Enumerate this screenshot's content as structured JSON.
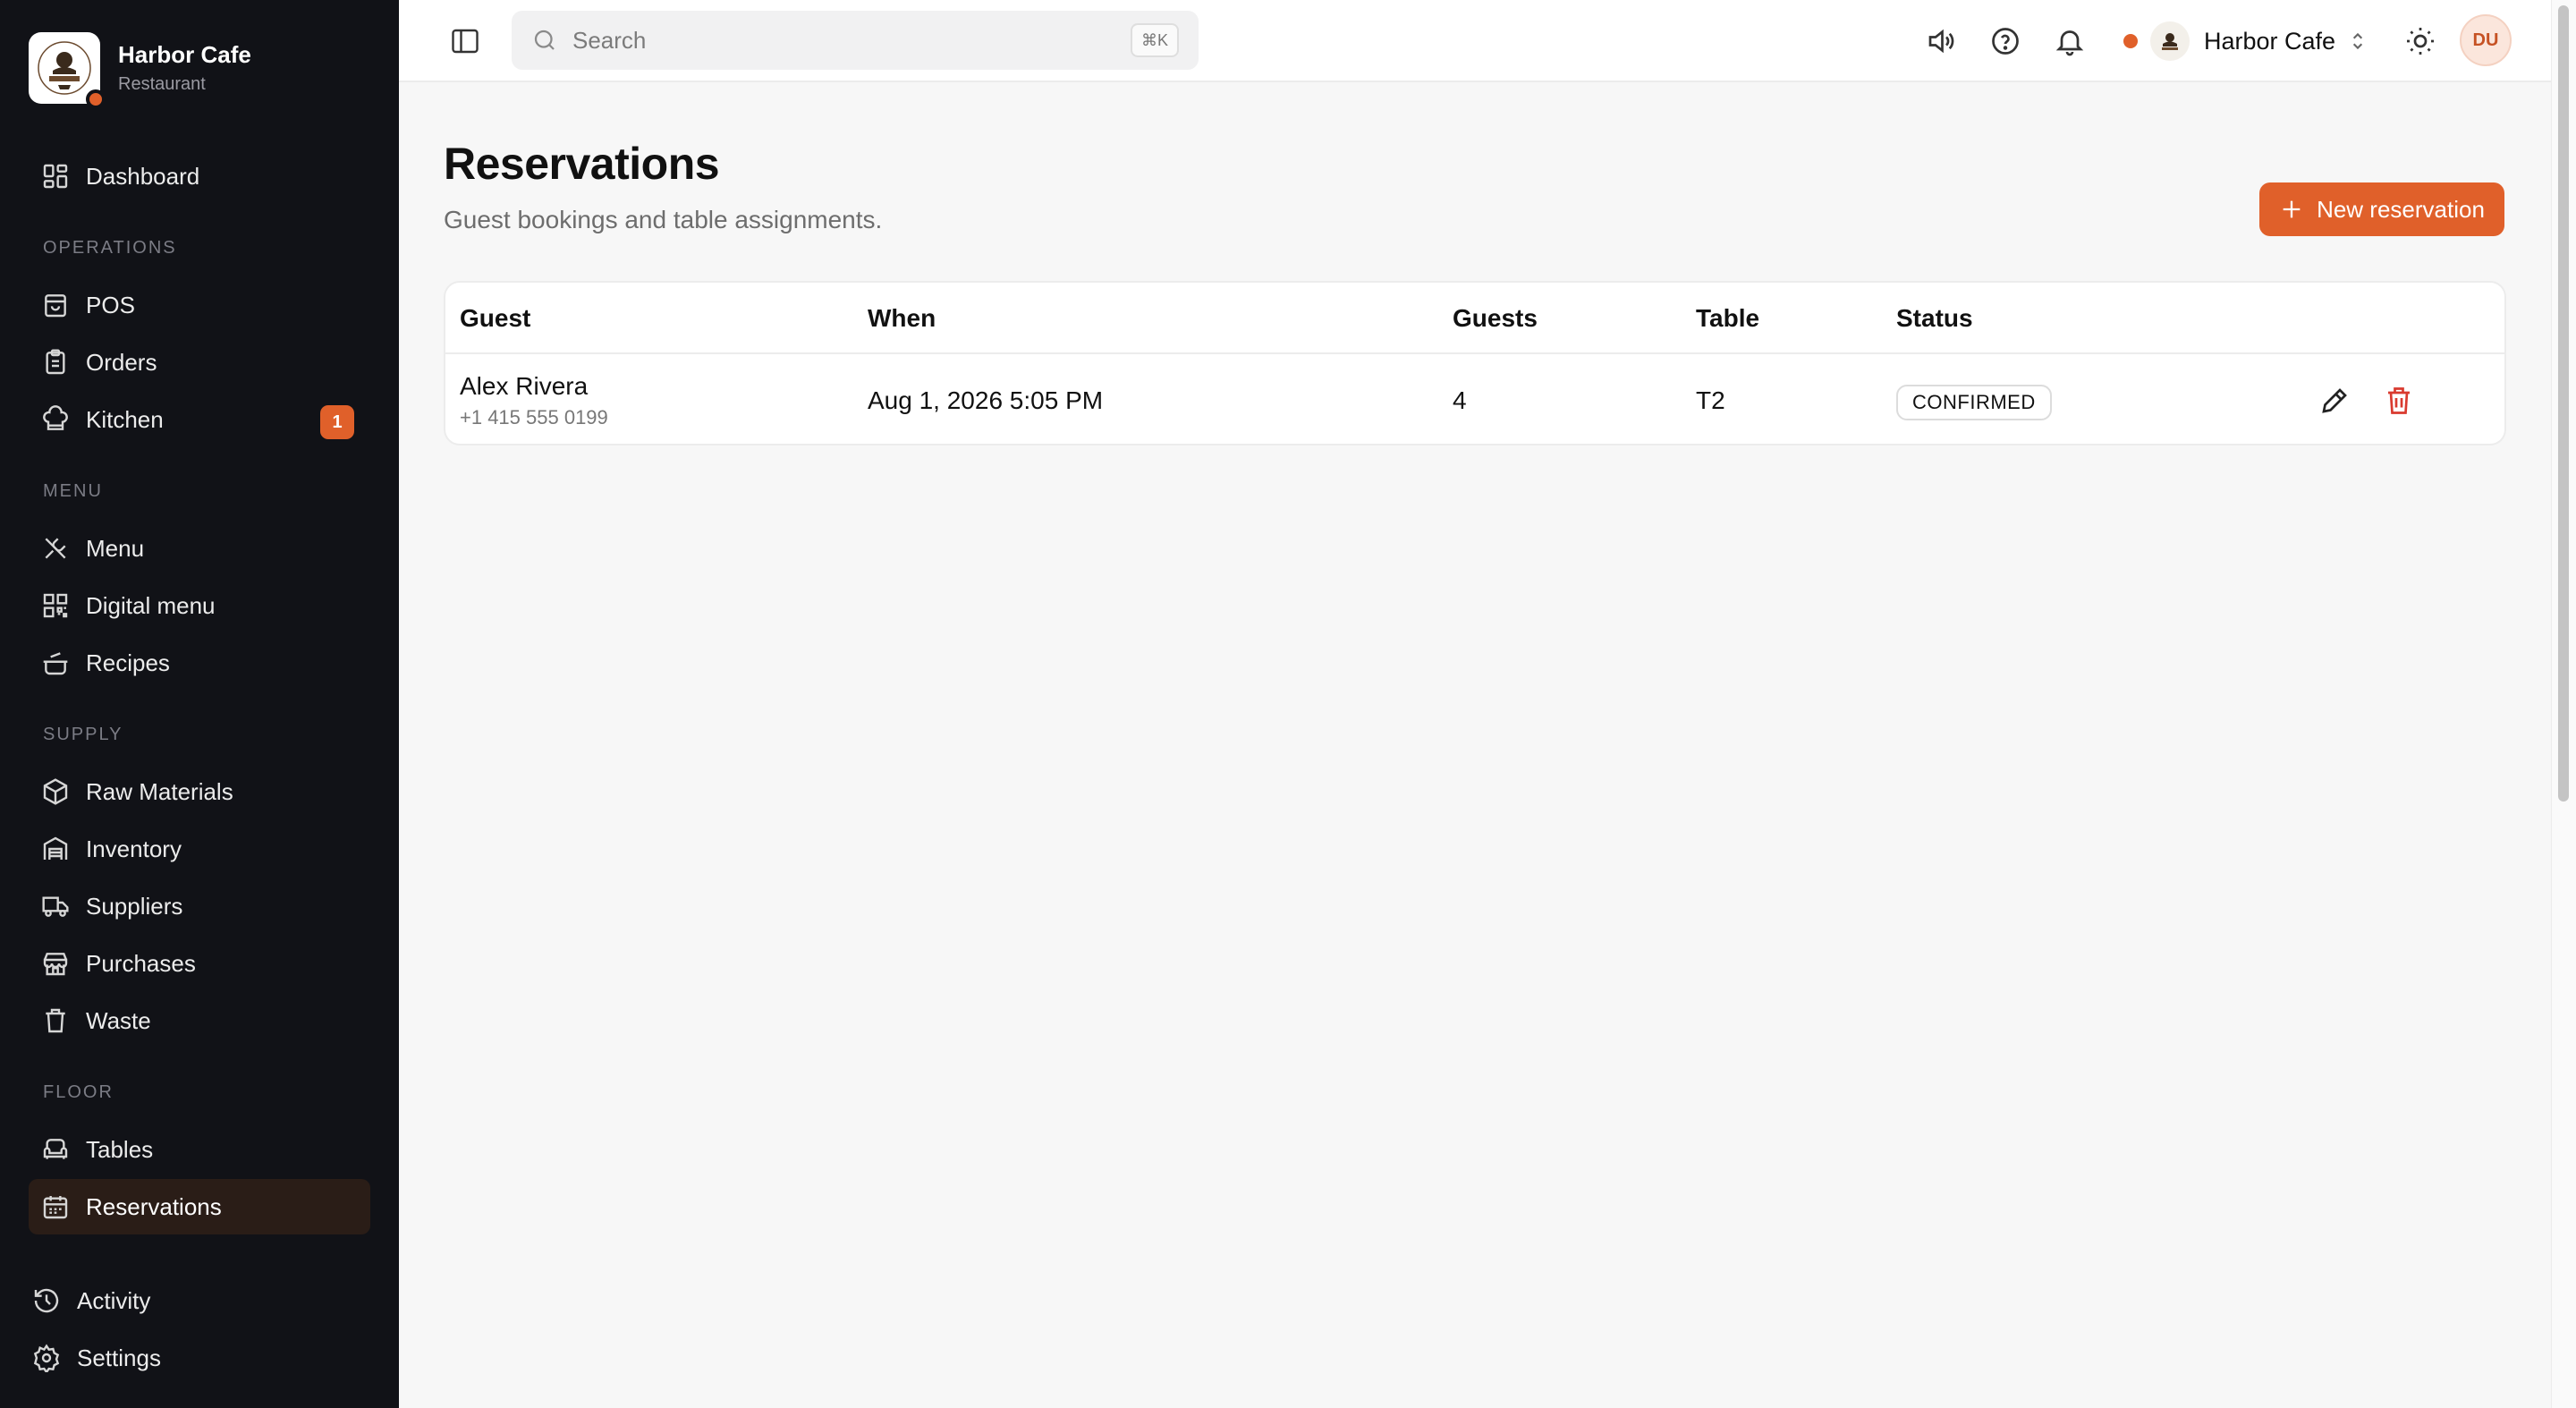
{
  "app": {
    "name": "Harbor Cafe",
    "subtitle": "Restaurant"
  },
  "sidebar": {
    "dashboard": "Dashboard",
    "sections": {
      "operations": "OPERATIONS",
      "menu": "MENU",
      "supply": "SUPPLY",
      "floor": "FLOOR"
    },
    "items": {
      "pos": "POS",
      "orders": "Orders",
      "kitchen": "Kitchen",
      "kitchen_badge": "1",
      "menu": "Menu",
      "digital_menu": "Digital menu",
      "recipes": "Recipes",
      "raw_materials": "Raw Materials",
      "inventory": "Inventory",
      "suppliers": "Suppliers",
      "purchases": "Purchases",
      "waste": "Waste",
      "tables": "Tables",
      "reservations": "Reservations"
    },
    "bottom": {
      "activity": "Activity",
      "settings": "Settings"
    },
    "active_item": "reservations"
  },
  "topbar": {
    "search_placeholder": "Search",
    "search_shortcut": "⌘K",
    "store_name": "Harbor Cafe",
    "user_initials": "DU"
  },
  "page": {
    "title": "Reservations",
    "subtitle": "Guest bookings and table assignments.",
    "new_button": "New reservation"
  },
  "table": {
    "columns": [
      "Guest",
      "When",
      "Guests",
      "Table",
      "Status"
    ],
    "rows": [
      {
        "guest_name": "Alex Rivera",
        "guest_phone": "+1 415 555 0199",
        "when": "Aug 1, 2026 5:05 PM",
        "guests": "4",
        "table": "T2",
        "status": "CONFIRMED"
      }
    ]
  },
  "colors": {
    "accent": "#e0602a",
    "sidebar_bg": "#111217",
    "delete": "#d93a2f"
  }
}
